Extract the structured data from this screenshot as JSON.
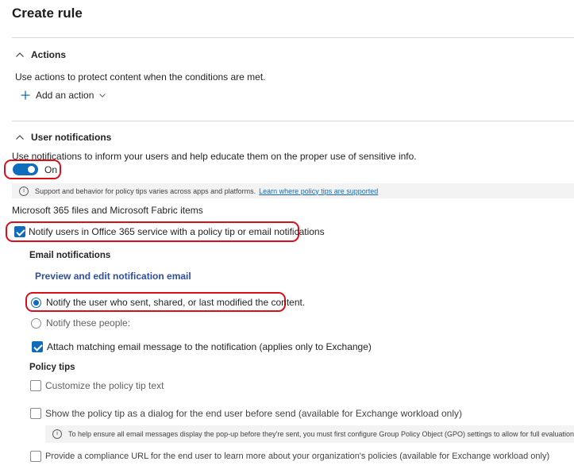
{
  "page_title": "Create rule",
  "actions": {
    "heading": "Actions",
    "description": "Use actions to protect content when the conditions are met.",
    "add_action_label": "Add an action"
  },
  "notifications": {
    "heading": "User notifications",
    "description": "Use notifications to inform your users and help educate them on the proper use of sensitive info.",
    "toggle_label": "On",
    "info_text": "Support and behavior for policy tips varies across apps and platforms.",
    "info_link": "Learn where policy tips are supported",
    "files_heading": "Microsoft 365 files and Microsoft Fabric items",
    "notify_checkbox_label": "Notify users in Office 365 service with a policy tip or email notifications",
    "email_heading": "Email notifications",
    "preview_link": "Preview and edit notification email",
    "radio_1": "Notify the user who sent, shared, or last modified the content.",
    "radio_2": "Notify these people:",
    "attach_label": "Attach matching email message to the notification (applies only to Exchange)",
    "policy_tips_heading": "Policy tips",
    "customize_label": "Customize the policy tip text",
    "dialog_label": "Show the policy tip as a dialog for the end user before send (available for Exchange workload only)",
    "gpo_info": "To help ensure all email messages display the pop-up before they're sent, you must first configure Group Policy Object (GPO) settings to allow for full evaluation",
    "compliance_label": "Provide a compliance URL for the end user to learn more about your organization's policies (available for Exchange workload only)"
  },
  "state": {
    "toggle_on": true,
    "notify_checked": true,
    "radio_selected": 1,
    "attach_checked": true,
    "customize_checked": false,
    "dialog_checked": false,
    "compliance_checked": false
  },
  "colors": {
    "accent": "#0f6cbd",
    "highlight": "#d9101c",
    "link_bold": "#2e4e9e"
  }
}
